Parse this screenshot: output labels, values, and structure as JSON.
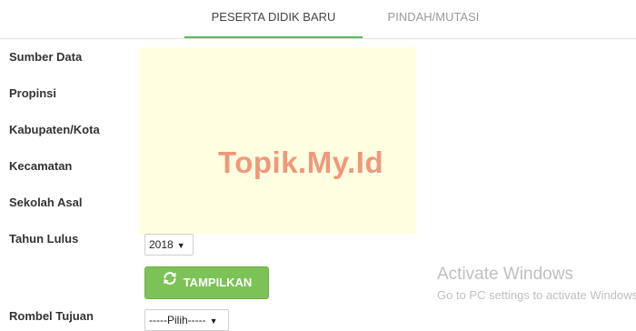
{
  "tabs": [
    {
      "label": "PESERTA DIDIK BARU",
      "active": true
    },
    {
      "label": "PINDAH/MUTASI",
      "active": false
    }
  ],
  "form": {
    "labels": {
      "sumber_data": "Sumber Data",
      "propinsi": "Propinsi",
      "kabupaten_kota": "Kabupaten/Kota",
      "kecamatan": "Kecamatan",
      "sekolah_asal": "Sekolah Asal",
      "tahun_lulus": "Tahun Lulus",
      "rombel_tujuan": "Rombel Tujuan"
    },
    "tahun_lulus_value": "2018",
    "rombel_tujuan_value": "-----Pilih-----",
    "dropdown_arrow": "▼",
    "submit_label": "TAMPILKAN",
    "submit_icon": "refresh-icon"
  },
  "watermark": "Topik.My.Id",
  "os_notice": {
    "title": "Activate Windows",
    "subtitle": "Go to PC settings to activate Windows."
  },
  "colors": {
    "accent_green": "#5cb85c",
    "button_green": "#7cc256",
    "overlay_yellow": "#fefee1",
    "watermark": "#f2977a"
  }
}
